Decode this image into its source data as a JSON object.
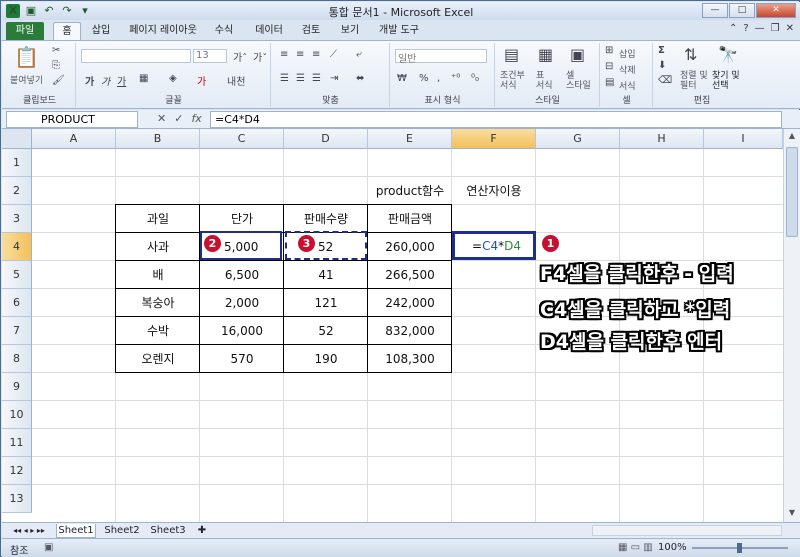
{
  "window": {
    "title": "통합 문서1 - Microsoft Excel"
  },
  "ribbon_tabs": [
    "파일",
    "홈",
    "삽입",
    "페이지 레이아웃",
    "수식",
    "데이터",
    "검토",
    "보기",
    "개발 도구"
  ],
  "ribbon_groups": {
    "clipboard": {
      "label": "클립보드",
      "paste": "붙여넣기"
    },
    "font": {
      "label": "글꼴",
      "size": "13"
    },
    "align": {
      "label": "맞춤"
    },
    "number": {
      "label": "표시 형식",
      "format": "일반"
    },
    "style": {
      "label": "스타일",
      "cond": "조건부\n서식",
      "table": "표\n서식",
      "cellstyle": "셀\n스타일"
    },
    "cells": {
      "label": "셀",
      "insert": "삽입",
      "delete": "삭제",
      "format": "서식"
    },
    "edit": {
      "label": "편집",
      "sort": "정렬 및\n필터",
      "find": "찾기 및\n선택"
    }
  },
  "formula_bar": {
    "name_box": "PRODUCT",
    "formula": "=C4*D4"
  },
  "columns": [
    "A",
    "B",
    "C",
    "D",
    "E",
    "F",
    "G",
    "H",
    "I"
  ],
  "rows": [
    "1",
    "2",
    "3",
    "4",
    "5",
    "6",
    "7",
    "8",
    "9",
    "10",
    "11",
    "12",
    "13"
  ],
  "cells": {
    "E2": "product함수",
    "F2": "연산자이용",
    "B3": "과일",
    "C3": "단가",
    "D3": "판매수량",
    "E3": "판매금액",
    "B4": "사과",
    "C4": "5,000",
    "D4": "52",
    "E4": "260,000",
    "F4": "=C4*D4",
    "B5": "배",
    "C5": "6,500",
    "D5": "41",
    "E5": "266,500",
    "B6": "복숭아",
    "C6": "2,000",
    "D6": "121",
    "E6": "242,000",
    "B7": "수박",
    "C7": "16,000",
    "D7": "52",
    "E7": "832,000",
    "B8": "오렌지",
    "C8": "570",
    "D8": "190",
    "E8": "108,300"
  },
  "formula_parts": {
    "c4": "C4",
    "star": "*",
    "d4": "D4",
    "eq": "="
  },
  "badges": {
    "one": "1",
    "two": "2",
    "three": "3"
  },
  "annotations": [
    "F4셀을 클릭한후 - 입력",
    "C4셀을 클릭하고 *입력",
    "D4셀을 클릭한후 엔터"
  ],
  "sheet_tabs": [
    "Sheet1",
    "Sheet2",
    "Sheet3"
  ],
  "status": {
    "mode": "참조",
    "zoom": "100%"
  },
  "colors": {
    "selection_border": "#1f2e8c",
    "badge": "#c8102e",
    "ref_blue": "#1f4ec9",
    "ref_green": "#2e8b3d"
  }
}
